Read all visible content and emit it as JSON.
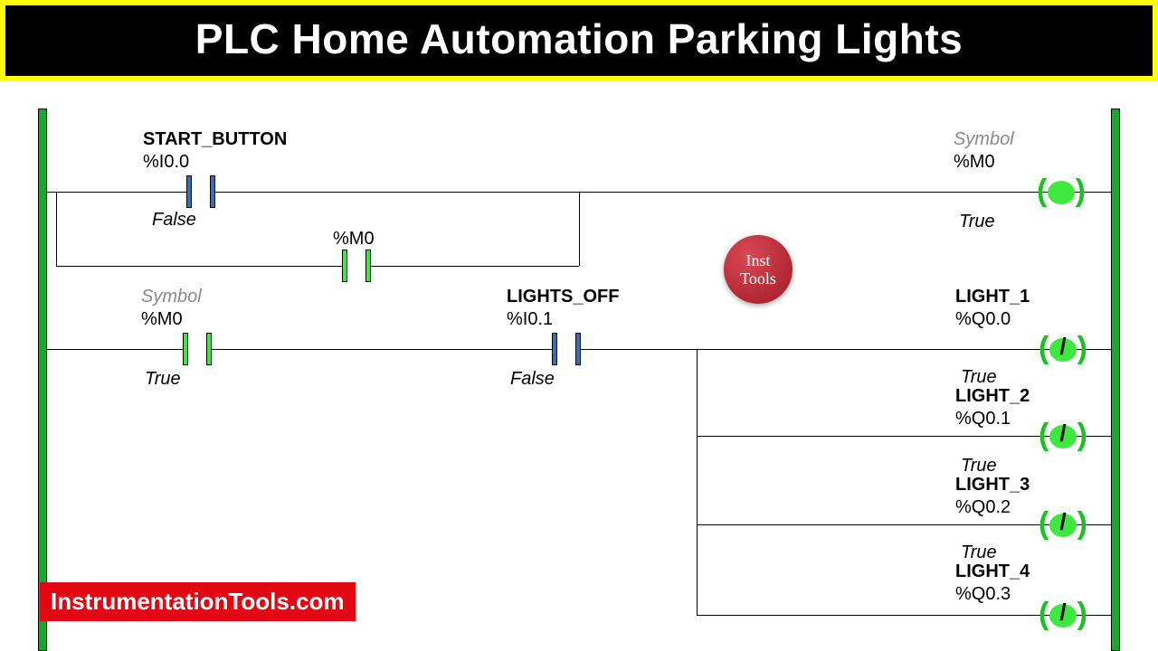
{
  "title": "PLC Home Automation Parking Lights",
  "rung1": {
    "contact1": {
      "name": "START_BUTTON",
      "addr": "%I0.0",
      "state": "False",
      "on": false
    },
    "branch_contact": {
      "addr": "%M0",
      "on": true
    },
    "coil": {
      "symbol_label": "Symbol",
      "addr": "%M0",
      "state": "True",
      "on": true,
      "negated": false
    }
  },
  "rung2": {
    "contact1": {
      "symbol_label": "Symbol",
      "addr": "%M0",
      "state": "True",
      "on": true
    },
    "contact2": {
      "name": "LIGHTS_OFF",
      "addr": "%I0.1",
      "state": "False",
      "on": false
    },
    "outputs": [
      {
        "name": "LIGHT_1",
        "addr": "%Q0.0",
        "state": "True",
        "on": true,
        "negated": true
      },
      {
        "name": "LIGHT_2",
        "addr": "%Q0.1",
        "state": "True",
        "on": true,
        "negated": true
      },
      {
        "name": "LIGHT_3",
        "addr": "%Q0.2",
        "state": "True",
        "on": true,
        "negated": true
      },
      {
        "name": "LIGHT_4",
        "addr": "%Q0.3",
        "state": "True",
        "on": true,
        "negated": true
      }
    ]
  },
  "watermark": {
    "line1": "Inst",
    "line2": "Tools"
  },
  "site": "InstrumentationTools.com"
}
